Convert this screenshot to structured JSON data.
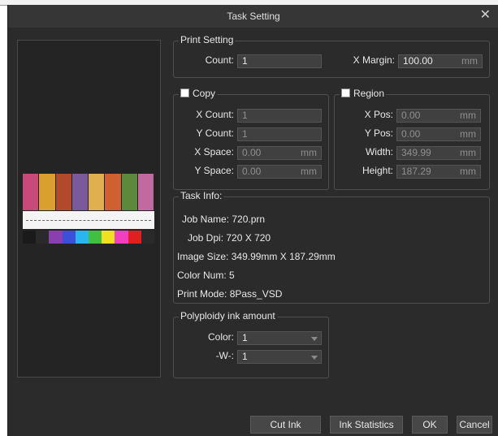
{
  "window": {
    "title": "Task Setting",
    "close_glyph": "✕"
  },
  "preview": {
    "image_colors": [
      "#c84a7a",
      "#d9a030",
      "#b04a2a",
      "#7a5a9a",
      "#e0b050",
      "#d06030",
      "#5a8a3a",
      "#c06aa0"
    ],
    "bar_colors": [
      "#1a1a1a",
      "#2a2a2a",
      "#8a3fb0",
      "#3b4fd8",
      "#29b6f0",
      "#40c040",
      "#f0e020",
      "#f040c0",
      "#e02020",
      "#2a2a2a"
    ]
  },
  "print_setting": {
    "title": "Print Setting",
    "count_label": "Count:",
    "count_value": "1",
    "xmargin_label": "X Margin:",
    "xmargin_value": "100.00",
    "xmargin_unit": "mm"
  },
  "copy": {
    "title": "Copy",
    "xcount_label": "X Count:",
    "xcount_value": "1",
    "ycount_label": "Y Count:",
    "ycount_value": "1",
    "xspace_label": "X Space:",
    "xspace_value": "0.00",
    "xspace_unit": "mm",
    "yspace_label": "Y Space:",
    "yspace_value": "0.00",
    "yspace_unit": "mm"
  },
  "region": {
    "title": "Region",
    "xpos_label": "X Pos:",
    "xpos_value": "0.00",
    "xpos_unit": "mm",
    "ypos_label": "Y Pos:",
    "ypos_value": "0.00",
    "ypos_unit": "mm",
    "width_label": "Width:",
    "width_value": "349.99",
    "width_unit": "mm",
    "height_label": "Height:",
    "height_value": "187.29",
    "height_unit": "mm"
  },
  "task_info": {
    "title": "Task Info:",
    "job_name_label": "Job Name:",
    "job_name_value": "720.prn",
    "job_dpi_label": "Job Dpi:",
    "job_dpi_value": "720 X 720",
    "image_size_label": "Image Size:",
    "image_size_value": "349.99mm X 187.29mm",
    "color_num_label": "Color Num:",
    "color_num_value": "5",
    "print_mode_label": "Print Mode:",
    "print_mode_value": "8Pass_VSD"
  },
  "polyploidy": {
    "title": "Polyploidy ink amount",
    "color_label": "Color:",
    "color_value": "1",
    "w_label": "-W-:",
    "w_value": "1"
  },
  "buttons": {
    "cut_ink": "Cut Ink",
    "ink_statistics": "Ink Statistics",
    "ok": "OK",
    "cancel": "Cancel"
  }
}
